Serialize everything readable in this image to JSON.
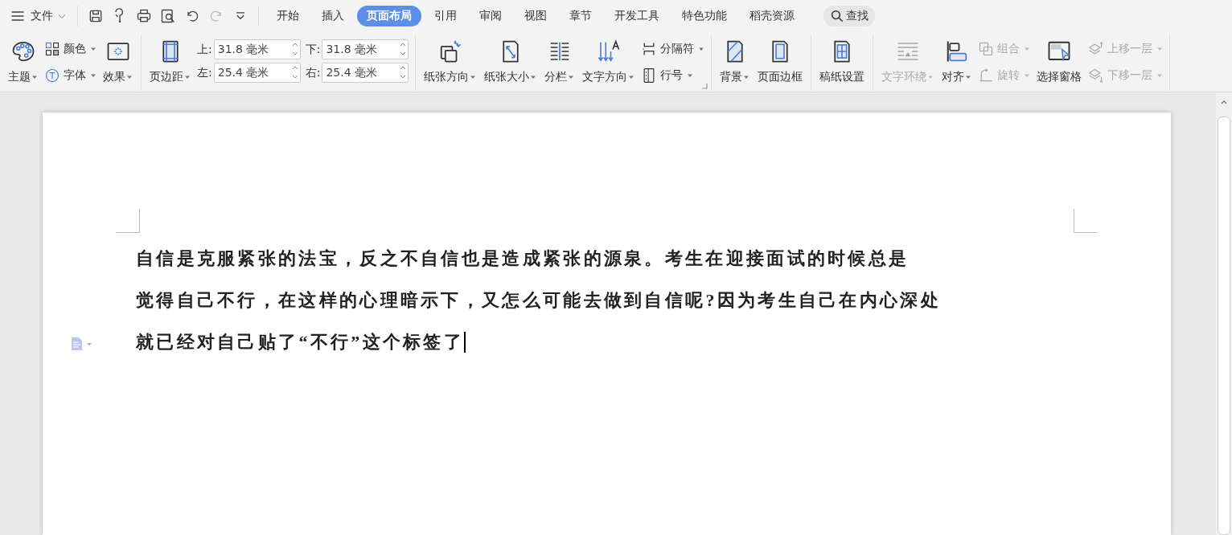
{
  "file_menu": {
    "label": "文件"
  },
  "quick_tools": [
    {
      "kind": "save",
      "disabled": false
    },
    {
      "kind": "paint",
      "disabled": false
    },
    {
      "kind": "print",
      "disabled": false
    },
    {
      "kind": "preview",
      "disabled": false
    },
    {
      "kind": "undo",
      "disabled": false
    },
    {
      "kind": "redo",
      "disabled": true
    },
    {
      "kind": "more",
      "disabled": false
    }
  ],
  "tabs": [
    {
      "label": "开始",
      "selected": false
    },
    {
      "label": "插入",
      "selected": false
    },
    {
      "label": "页面布局",
      "selected": true
    },
    {
      "label": "引用",
      "selected": false
    },
    {
      "label": "审阅",
      "selected": false
    },
    {
      "label": "视图",
      "selected": false
    },
    {
      "label": "章节",
      "selected": false
    },
    {
      "label": "开发工具",
      "selected": false
    },
    {
      "label": "特色功能",
      "selected": false
    },
    {
      "label": "稻壳资源",
      "selected": false
    }
  ],
  "search": {
    "label": "查找"
  },
  "ribbon": {
    "groups": [
      {
        "columns": [
          {
            "kind": "big",
            "label": "主题",
            "dropdown": true,
            "disabled": false
          },
          {
            "kind": "stack",
            "rows": [
              {
                "label": "颜色",
                "dropdown": true,
                "disabled": false
              },
              {
                "label": "字体",
                "dropdown": true,
                "disabled": false
              }
            ]
          },
          {
            "kind": "big",
            "label": "效果",
            "dropdown": true,
            "disabled": false
          }
        ]
      },
      {
        "columns": [
          {
            "kind": "big",
            "label": "页边距",
            "dropdown": true,
            "disabled": false
          },
          {
            "kind": "fields",
            "rows": [
              {
                "label": "上:",
                "value": "31.8 毫米"
              },
              {
                "label": "左:",
                "value": "25.4 毫米"
              }
            ]
          },
          {
            "kind": "fields",
            "rows": [
              {
                "label": "下:",
                "value": "31.8 毫米"
              },
              {
                "label": "右:",
                "value": "25.4 毫米"
              }
            ]
          }
        ]
      },
      {
        "columns": [
          {
            "kind": "big",
            "label": "纸张方向",
            "dropdown": true,
            "disabled": false
          },
          {
            "kind": "big",
            "label": "纸张大小",
            "dropdown": true,
            "disabled": false
          },
          {
            "kind": "big",
            "label": "分栏",
            "dropdown": true,
            "disabled": false
          },
          {
            "kind": "big",
            "label": "文字方向",
            "dropdown": true,
            "disabled": false
          },
          {
            "kind": "stack",
            "rows": [
              {
                "label": "分隔符",
                "dropdown": true,
                "disabled": false
              },
              {
                "label": "行号",
                "dropdown": true,
                "disabled": false
              }
            ]
          }
        ]
      },
      {
        "columns": [
          {
            "kind": "big",
            "label": "背景",
            "dropdown": true,
            "disabled": false
          },
          {
            "kind": "big",
            "label": "页面边框",
            "dropdown": false,
            "disabled": false
          }
        ]
      },
      {
        "columns": [
          {
            "kind": "big",
            "label": "稿纸设置",
            "dropdown": false,
            "disabled": false
          }
        ]
      },
      {
        "columns": [
          {
            "kind": "big",
            "label": "文字环绕",
            "dropdown": true,
            "disabled": true
          },
          {
            "kind": "big",
            "label": "对齐",
            "dropdown": true,
            "disabled": false
          },
          {
            "kind": "stack",
            "rows": [
              {
                "label": "组合",
                "dropdown": true,
                "disabled": true
              },
              {
                "label": "旋转",
                "dropdown": true,
                "disabled": true
              }
            ]
          },
          {
            "kind": "big",
            "label": "选择窗格",
            "dropdown": false,
            "disabled": false
          },
          {
            "kind": "stack",
            "rows": [
              {
                "label": "上移一层",
                "dropdown": true,
                "disabled": true
              },
              {
                "label": "下移一层",
                "dropdown": true,
                "disabled": true
              }
            ]
          }
        ]
      }
    ]
  },
  "document": {
    "lines": [
      "自信是克服紧张的法宝，反之不自信也是造成紧张的源泉。考生在迎接面试的时候总是",
      "觉得自己不行，在这样的心理暗示下，又怎么可能去做到自信呢?因为考生自己在内心深处",
      "就已经对自己贴了“不行”这个标签了"
    ],
    "cursor": true
  }
}
